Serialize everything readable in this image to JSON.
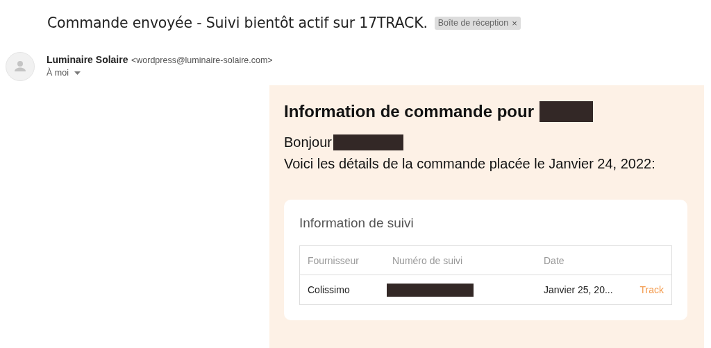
{
  "subject": "Commande envoyée - Suivi bientôt actif sur 17TRACK.",
  "label": {
    "text": "Boîte de réception",
    "close": "×"
  },
  "sender": {
    "name": "Luminaire Solaire",
    "email": "<wordpress@luminaire-solaire.com>",
    "recipient": "À moi"
  },
  "email": {
    "heading": "Information de commande pour",
    "greeting": "Bonjour",
    "intro": "Voici les détails de la commande placée le Janvier 24, 2022:",
    "tracking": {
      "title": "Information de suivi",
      "columns": [
        "Fournisseur",
        "Numéro de suivi",
        "Date"
      ],
      "rows": [
        {
          "carrier": "Colissimo",
          "date": "Janvier 25, 20...",
          "action": "Track"
        }
      ]
    }
  }
}
